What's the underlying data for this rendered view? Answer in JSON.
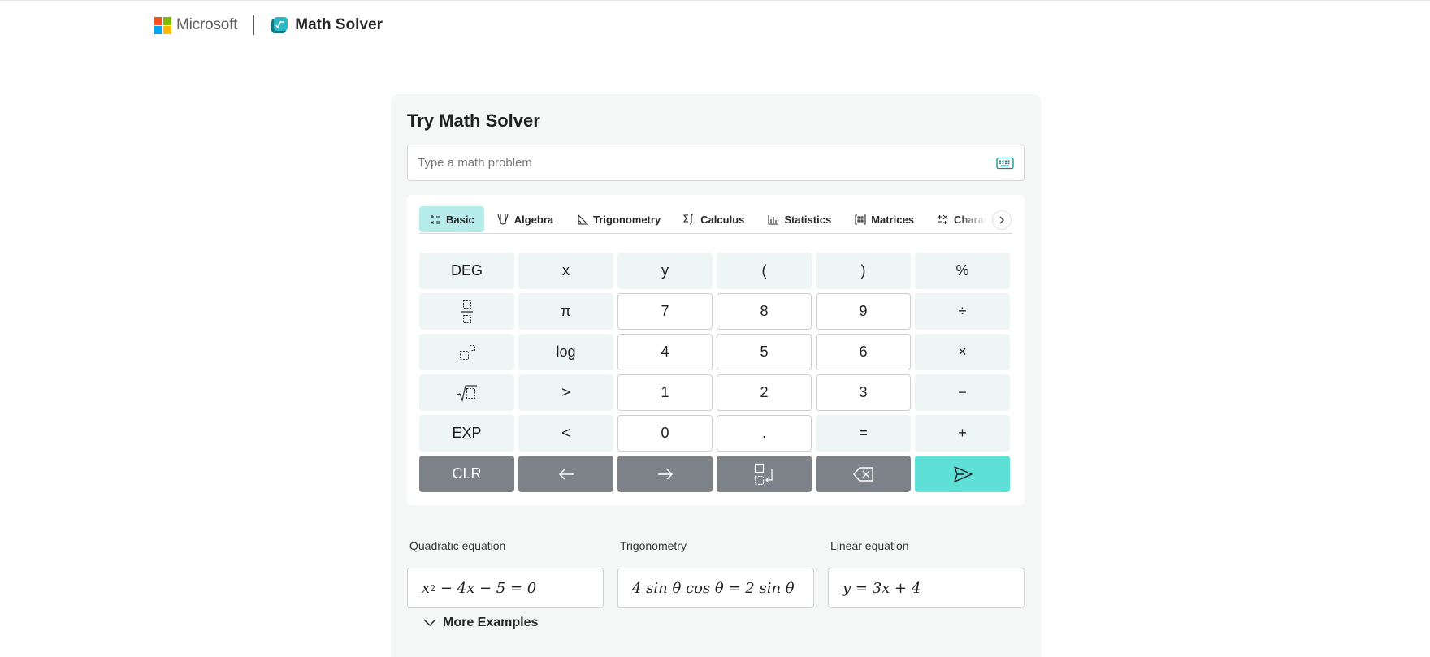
{
  "header": {
    "brand": "Microsoft",
    "app_title": "Math Solver",
    "logo_colors": [
      "#f25022",
      "#7fba00",
      "#00a4ef",
      "#ffb900"
    ]
  },
  "card": {
    "title": "Try Math Solver",
    "search_placeholder": "Type a math problem"
  },
  "tabs": [
    {
      "label": "Basic",
      "icon": "basic-ops-icon",
      "active": true
    },
    {
      "label": "Algebra",
      "icon": "algebra-icon",
      "active": false
    },
    {
      "label": "Trigonometry",
      "icon": "triangle-icon",
      "active": false
    },
    {
      "label": "Calculus",
      "icon": "sigma-integral-icon",
      "active": false
    },
    {
      "label": "Statistics",
      "icon": "bar-chart-icon",
      "active": false
    },
    {
      "label": "Matrices",
      "icon": "matrix-icon",
      "active": false
    },
    {
      "label": "Characters",
      "icon": "characters-icon",
      "active": false
    }
  ],
  "keys": {
    "r1": [
      "DEG",
      "x",
      "y",
      "(",
      ")",
      "%"
    ],
    "r2": [
      "π",
      "7",
      "8",
      "9",
      "÷"
    ],
    "r3": [
      "log",
      "4",
      "5",
      "6",
      "×"
    ],
    "r4": [
      ">",
      "1",
      "2",
      "3",
      "−"
    ],
    "r5": [
      "EXP",
      "<",
      "0",
      ".",
      "=",
      "+"
    ],
    "r6": [
      "CLR"
    ]
  },
  "examples": [
    {
      "label": "Quadratic equation",
      "expr_base": "x",
      "expr_sup": "2",
      "expr_rest": " − 4x − 5 = 0"
    },
    {
      "label": "Trigonometry",
      "expr": "4 sin θ cos θ = 2 sin θ"
    },
    {
      "label": "Linear equation",
      "expr": "y = 3x + 4"
    }
  ],
  "more_examples": "More Examples",
  "colors": {
    "accent": "#5fe0d7",
    "tab_active": "#b5ecea",
    "dark_key": "#7d8188"
  }
}
